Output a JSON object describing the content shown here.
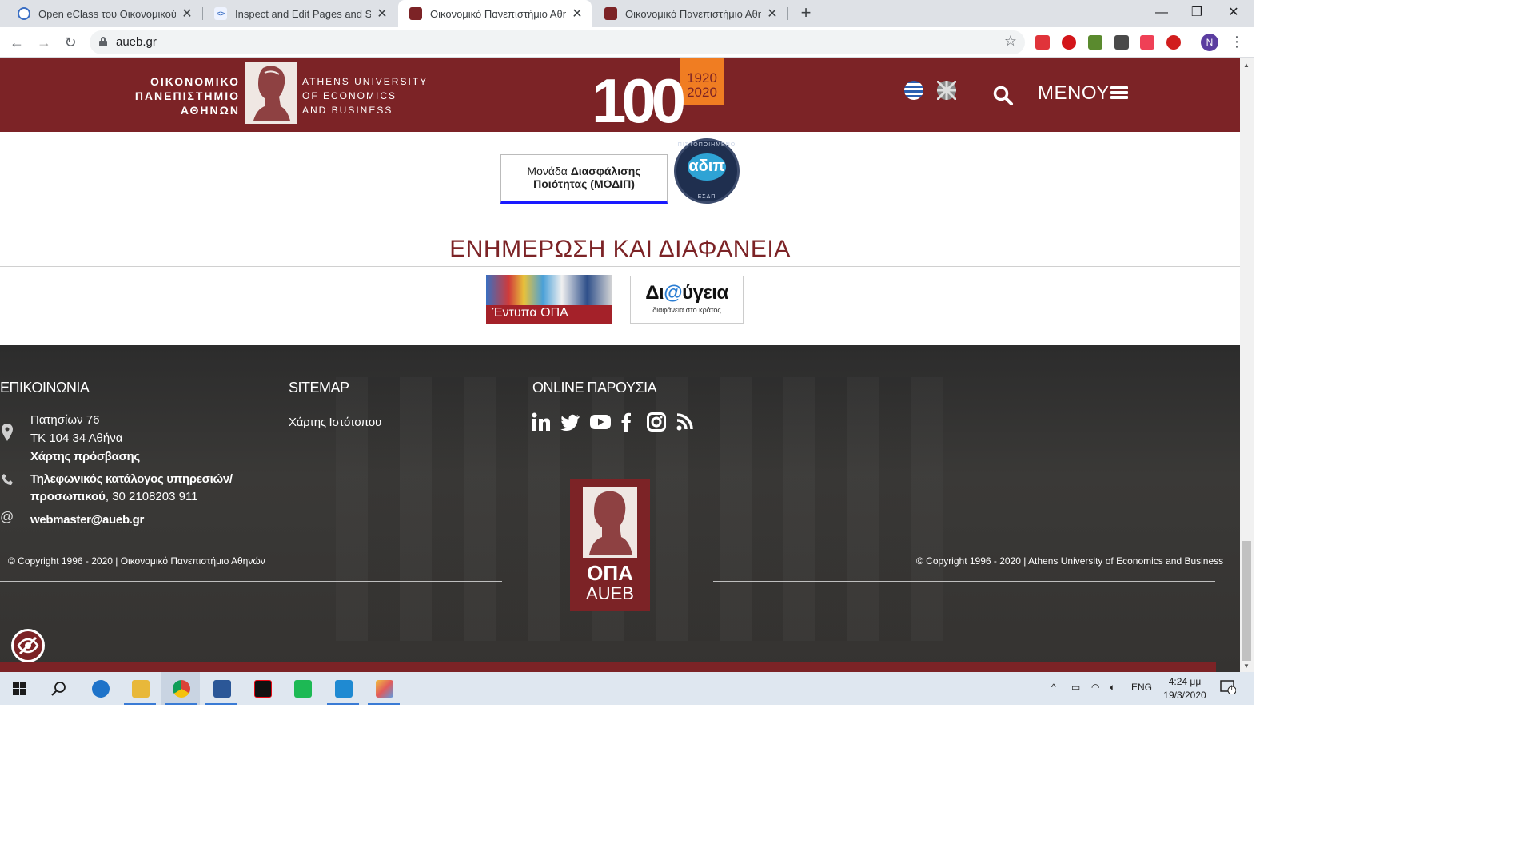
{
  "browser": {
    "tabs": [
      {
        "title": "Open eClass του Οικονομικού Πα",
        "active": false
      },
      {
        "title": "Inspect and Edit Pages and Styles",
        "active": false
      },
      {
        "title": "Οικονομικό Πανεπιστήμιο Αθηνώ",
        "active": true
      },
      {
        "title": "Οικονομικό Πανεπιστήμιο Αθηνώ",
        "active": false
      }
    ],
    "new_tab_label": "+",
    "url": "aueb.gr",
    "profile_initial": "N",
    "extensions": [
      "youtube-ext-icon",
      "ublock-icon",
      "pencil-ext-icon",
      "download-ext-icon",
      "pocket-icon",
      "adblock-plus-icon"
    ]
  },
  "header": {
    "greek_name": [
      "ΟΙΚΟΝΟΜΙΚΟ",
      "ΠΑΝΕΠΙΣΤΗΜΙΟ",
      "ΑΘΗΝΩΝ"
    ],
    "english_name": [
      "ATHENS UNIVERSITY",
      "OF ECONOMICS",
      "AND BUSINESS"
    ],
    "anniversary": {
      "number": "100",
      "years_top": "1920",
      "years_bottom": "2020"
    },
    "menu_label": "ΜΕΝΟΥ"
  },
  "quality": {
    "modip_line1_normal": "Μονάδα ",
    "modip_line1_bold": "Διασφάλισης",
    "modip_line2": "Ποιότητας (ΜΟΔΙΠ)",
    "adip_logo": "αδιπ",
    "adip_ring_top": "ΠΙΣΤΟΠΟΙΗΜΕΝΟ",
    "adip_ring_bottom": "ΕΣΔΠ"
  },
  "transparency": {
    "title": "ΕΝΗΜΕΡΩΣΗ ΚΑΙ ΔΙΑΦΑΝΕΙΑ",
    "entypa_label": "Έντυπα ΟΠΑ",
    "diavgeia_pre": "Δι",
    "diavgeia_at": "@",
    "diavgeia_post": "ύγεια",
    "diavgeia_sub": "διαφάνεια στο κράτος"
  },
  "footer": {
    "contact_heading": "ΕΠΙΚΟΙΝΩΝΙΑ",
    "address_line1": "Πατησίων 76",
    "address_line2": "ΤΚ 104 34 Αθήνα",
    "map_link": "Χάρτης πρόσβασης",
    "phone_link_line1": "Τηλεφωνικός κατάλογος υπηρεσιών/",
    "phone_link_line2": "προσωπικού",
    "phone_number": ", 30 2108203 911",
    "email": "webmaster@aueb.gr",
    "sitemap_heading": "SITEMAP",
    "sitemap_link": "Χάρτης Ιστότοπου",
    "online_heading": "ONLINE ΠΑΡΟΥΣΙΑ",
    "social": [
      "linkedin-icon",
      "twitter-icon",
      "youtube-icon",
      "facebook-icon",
      "instagram-icon",
      "rss-icon"
    ],
    "copyright_gr": "© Copyright 1996 - 2020 | Οικονομικό Πανεπιστήμιο Αθηνών",
    "copyright_en": "© Copyright 1996 - 2020 | Athens University of Economics and Business",
    "logo_opa": "ΟΠΑ",
    "logo_aueb": "AUEB"
  },
  "taskbar": {
    "apps": [
      "windows-start-icon",
      "search-icon",
      "edge-icon",
      "file-explorer-icon",
      "chrome-icon",
      "word-icon",
      "netflix-icon",
      "spotify-icon",
      "vscode-icon",
      "paint-icon"
    ],
    "language": "ENG",
    "time": "4:24 μμ",
    "date": "19/3/2020",
    "notification_count": "1"
  },
  "colors": {
    "brand": "#7c2326",
    "accent_orange": "#f07d22",
    "modip_blue": "#1a1aff"
  }
}
